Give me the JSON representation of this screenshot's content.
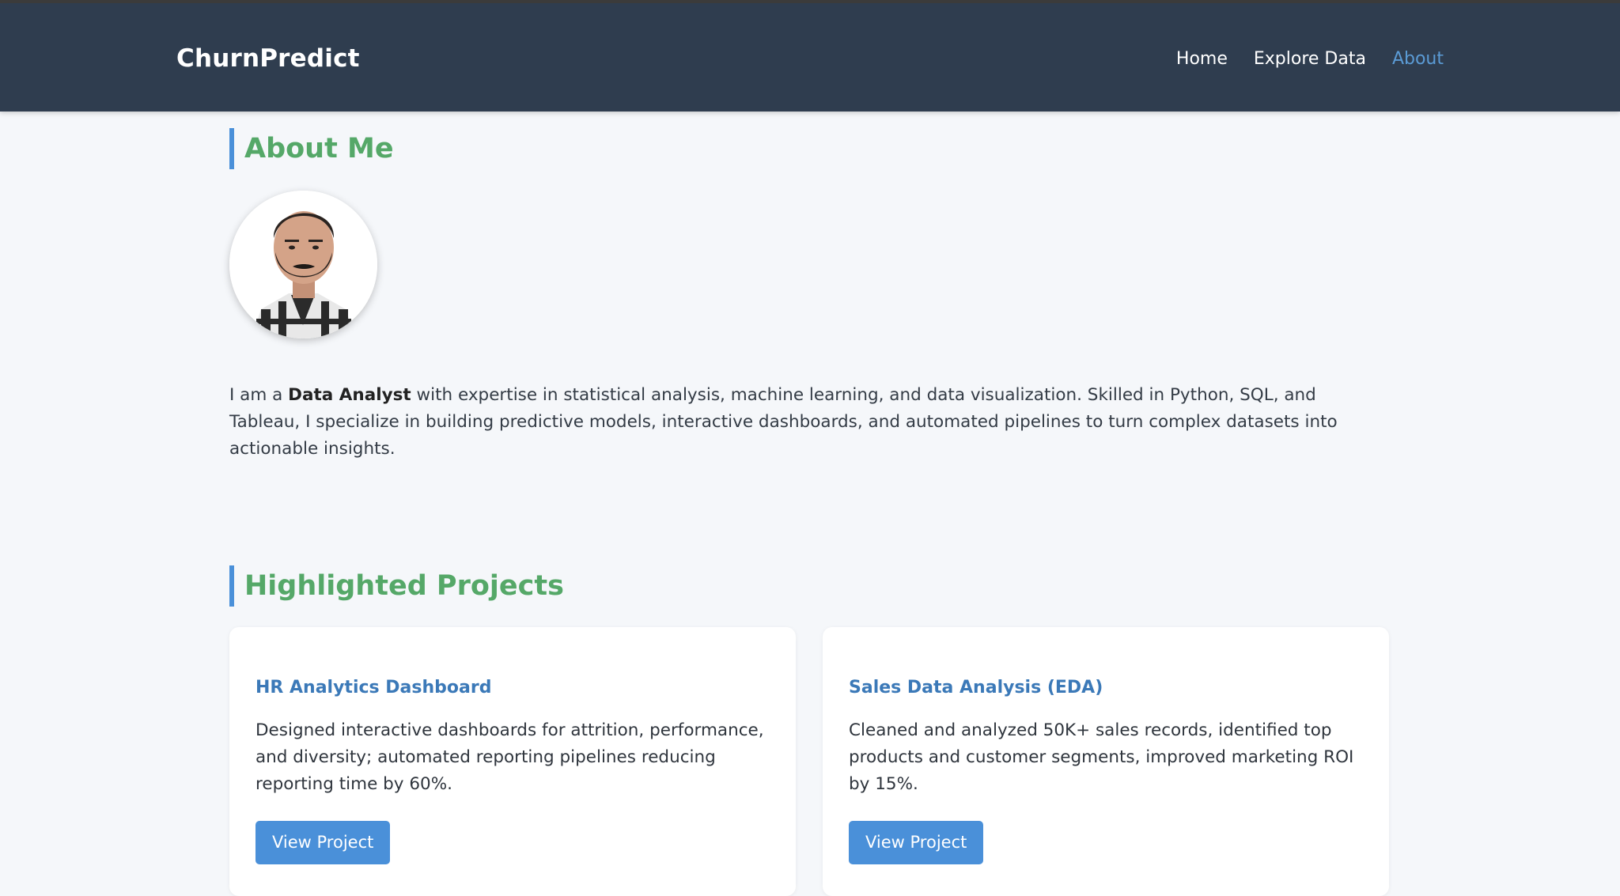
{
  "header": {
    "brand": "ChurnPredict",
    "nav": [
      {
        "label": "Home",
        "active": false
      },
      {
        "label": "Explore Data",
        "active": false
      },
      {
        "label": "About",
        "active": true
      }
    ]
  },
  "about": {
    "title": "About Me",
    "bio_prefix": "I am a ",
    "bio_bold": "Data Analyst",
    "bio_suffix": " with expertise in statistical analysis, machine learning, and data visualization. Skilled in Python, SQL, and Tableau, I specialize in building predictive models, interactive dashboards, and automated pipelines to turn complex datasets into actionable insights."
  },
  "projects": {
    "title": "Highlighted Projects",
    "items": [
      {
        "title": "HR Analytics Dashboard",
        "description": "Designed interactive dashboards for attrition, performance, and diversity; automated reporting pipelines reducing reporting time by 60%.",
        "button": "View Project"
      },
      {
        "title": "Sales Data Analysis (EDA)",
        "description": "Cleaned and analyzed 50K+ sales records, identified top products and customer segments, improved marketing ROI by 15%.",
        "button": "View Project"
      }
    ]
  },
  "colors": {
    "header_bg": "#2f3d4f",
    "accent_green": "#55a868",
    "accent_blue": "#4a90d9",
    "nav_active": "#5b9bd5"
  }
}
